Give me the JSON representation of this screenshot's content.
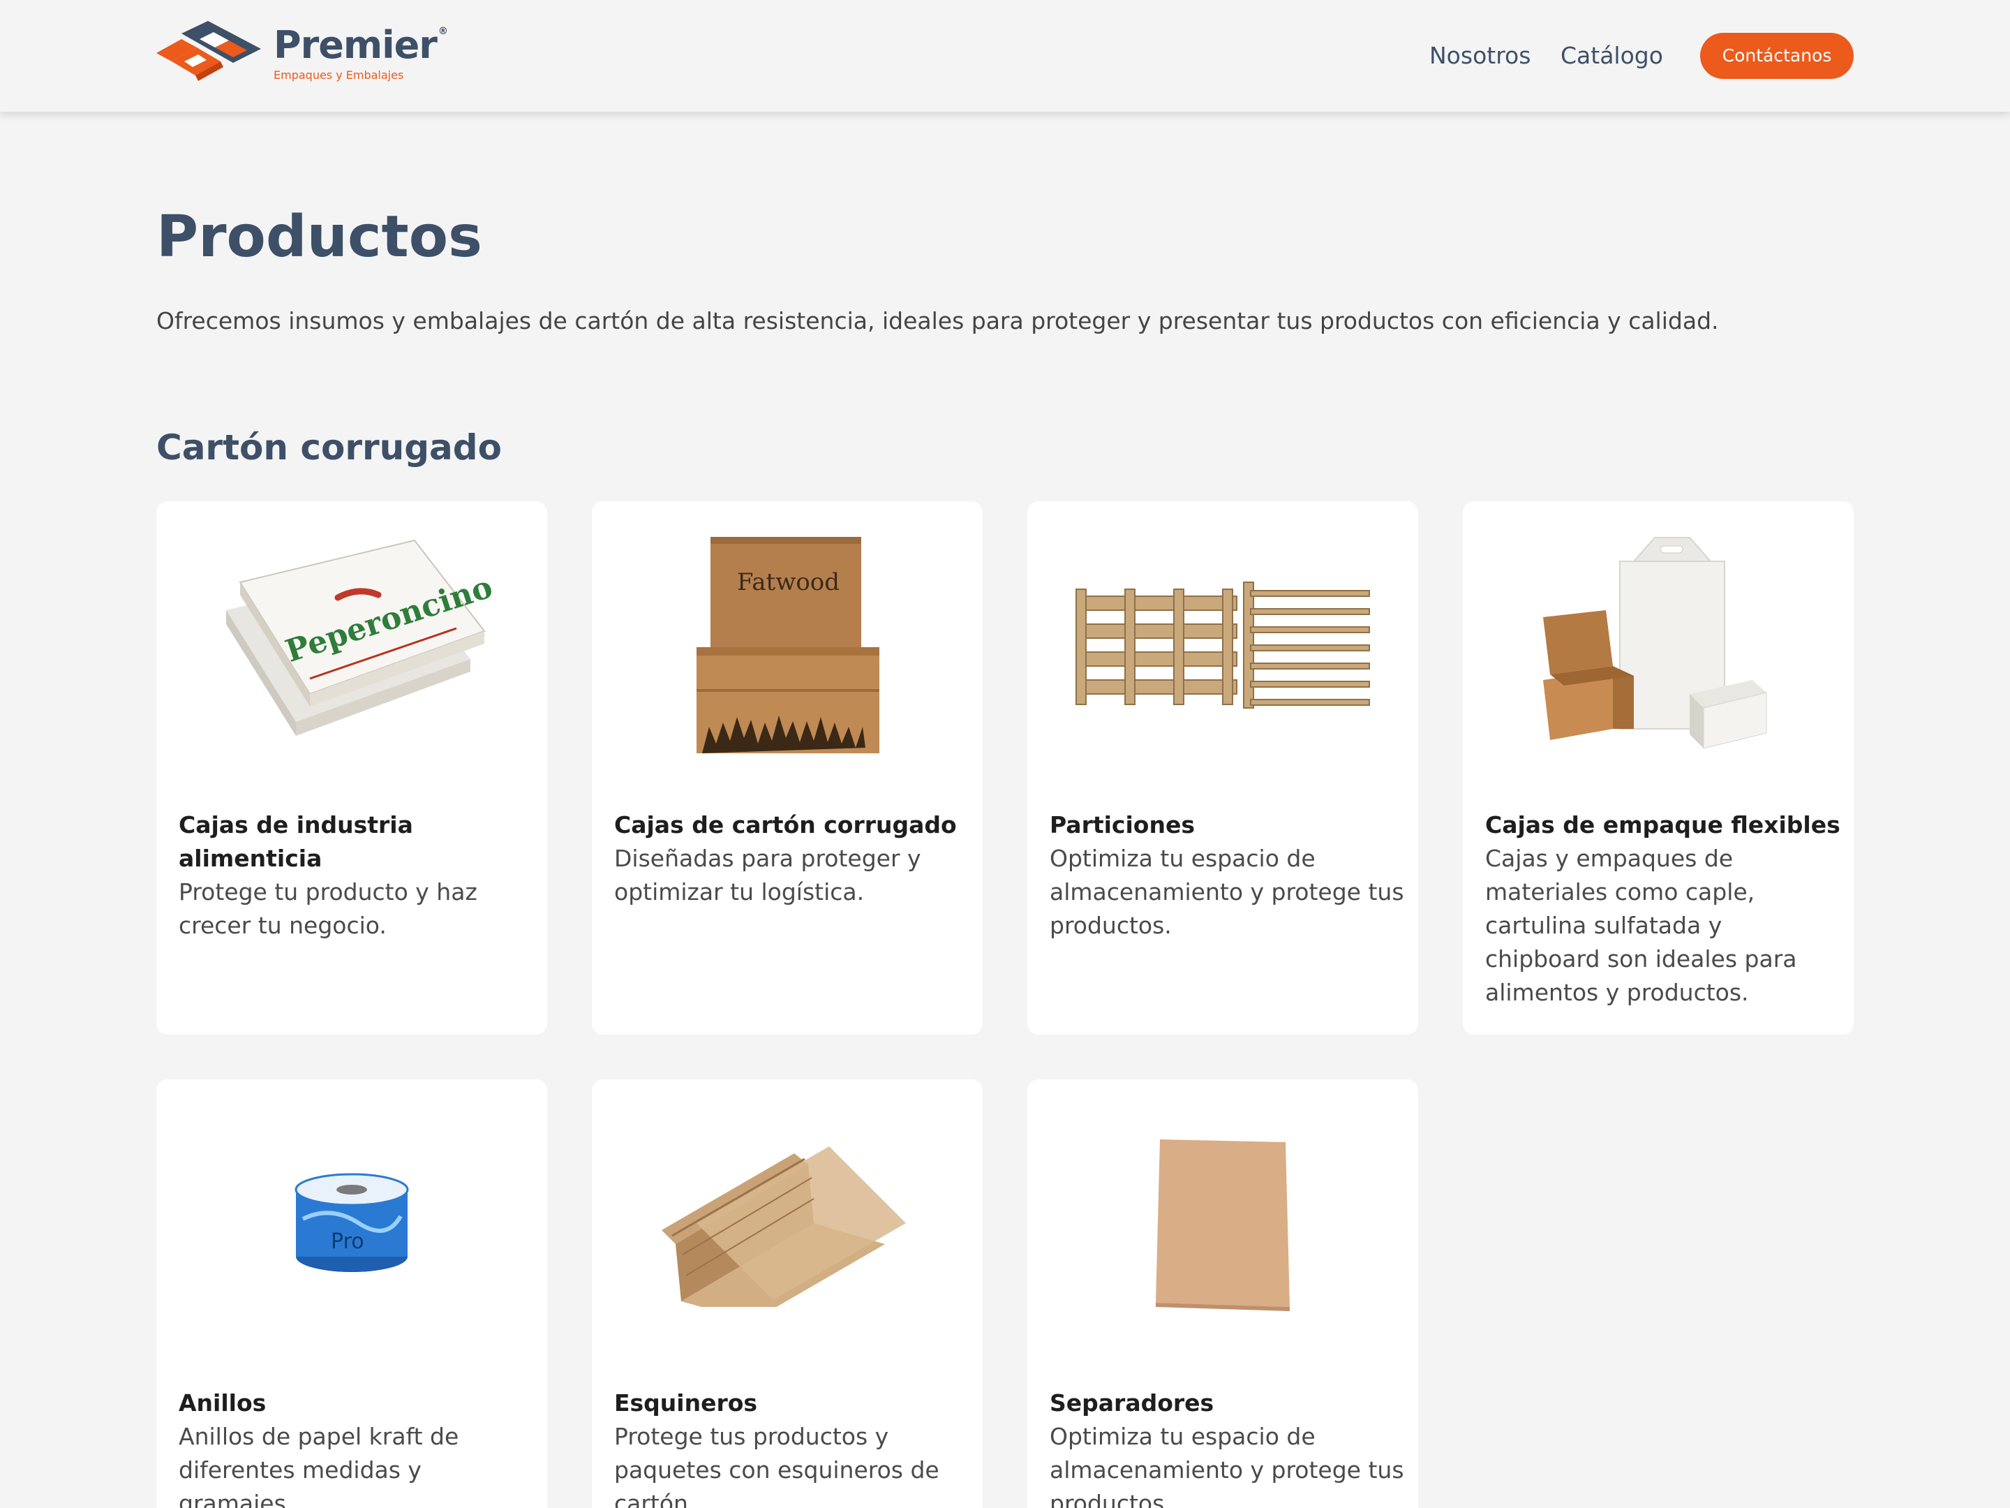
{
  "header": {
    "logo": {
      "name": "Premier",
      "registered": "®",
      "tagline": "Empaques y Embalajes"
    },
    "nav": [
      {
        "label": "Nosotros"
      },
      {
        "label": "Catálogo"
      }
    ],
    "cta_label": "Contáctanos"
  },
  "main": {
    "title": "Productos",
    "subtitle": "Ofrecemos insumos y embalajes de cartón de alta resistencia, ideales para proteger y presentar tus productos con eficiencia y calidad.",
    "section_title": "Cartón corrugado",
    "products": [
      {
        "title": "Cajas de industria alimenticia",
        "description": "Protege tu producto y haz crecer tu negocio.",
        "image_text": "Peperoncino"
      },
      {
        "title": "Cajas de cartón corrugado",
        "description": "Diseñadas para proteger y optimizar tu logística.",
        "image_text": "Fatwood"
      },
      {
        "title": "Particiones",
        "description": "Optimiza tu espacio de almacenamiento y protege tus productos."
      },
      {
        "title": "Cajas de empaque flexibles",
        "description": "Cajas y empaques de materiales como caple, cartulina sulfatada y chipboard son ideales para alimentos y productos."
      },
      {
        "title": "Anillos",
        "description": "Anillos de papel kraft de diferentes medidas y gramajes.",
        "image_text": "Pro"
      },
      {
        "title": "Esquineros",
        "description": "Protege tus productos y paquetes con esquineros de cartón."
      },
      {
        "title": "Separadores",
        "description": "Optimiza tu espacio de almacenamiento y protege tus productos."
      }
    ]
  },
  "colors": {
    "accent": "#ec5a1c",
    "heading": "#3e4f68",
    "background": "#f4f4f4",
    "card": "#ffffff"
  }
}
